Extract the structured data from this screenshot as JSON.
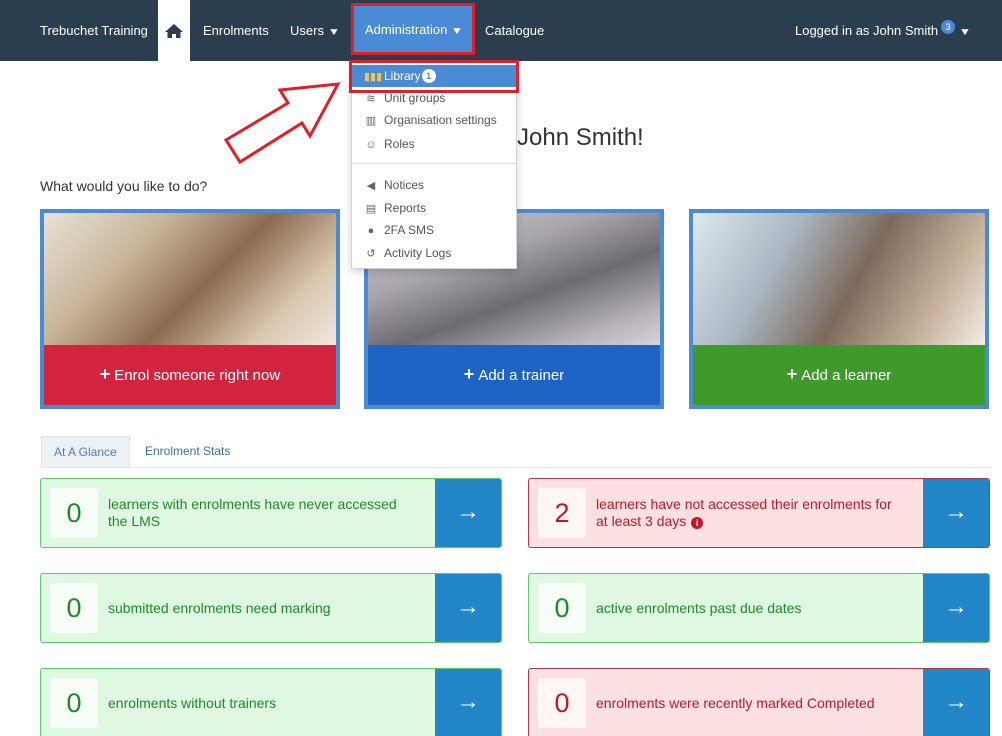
{
  "nav": {
    "brand": "Trebuchet Training",
    "enrolments": "Enrolments",
    "users": "Users",
    "administration": "Administration",
    "catalogue": "Catalogue",
    "logged_in": "Logged in as John Smith",
    "user_badge": "3",
    "home_icon": "home-icon",
    "caret_icon": "caret-down-icon"
  },
  "dropdown": {
    "items": [
      {
        "label": "Library",
        "icon": "library-icon",
        "badge": "1",
        "active": true
      },
      {
        "label": "Unit groups",
        "icon": "layers-icon"
      },
      {
        "label": "Organisation settings",
        "icon": "organisation-icon"
      },
      {
        "label": "Roles",
        "icon": "roles-icon"
      },
      {
        "label": "Notices",
        "icon": "megaphone-icon"
      },
      {
        "label": "Reports",
        "icon": "report-icon"
      },
      {
        "label": "2FA SMS",
        "icon": "sms-icon"
      },
      {
        "label": "Activity Logs",
        "icon": "history-icon"
      }
    ]
  },
  "welcome": "John Smith!",
  "prompt": "What would you like to do?",
  "cards": [
    {
      "label": "Enrol someone right now",
      "color": "#d2233f"
    },
    {
      "label": "Add a trainer",
      "color": "#1f63c4"
    },
    {
      "label": "Add a learner",
      "color": "#3f9a2c"
    }
  ],
  "tabs": {
    "active": "At A Glance",
    "inactive": "Enrolment Stats"
  },
  "stats": [
    {
      "value": "0",
      "text": "learners with enrolments have never accessed the LMS",
      "status": "good"
    },
    {
      "value": "2",
      "text": "learners have not accessed their enrolments for at least 3 days",
      "status": "bad",
      "info": "i"
    },
    {
      "value": "0",
      "text": "submitted enrolments need marking",
      "status": "good"
    },
    {
      "value": "0",
      "text": "active enrolments past due dates",
      "status": "good"
    },
    {
      "value": "0",
      "text": "enrolments without trainers",
      "status": "good"
    },
    {
      "value": "0",
      "text": "enrolments were recently marked Completed",
      "status": "bad"
    }
  ],
  "colors": {
    "nav_bg": "#2b3e50",
    "accent": "#4a8bd6",
    "highlight": "#e21f26",
    "go_button": "#2187c6"
  }
}
